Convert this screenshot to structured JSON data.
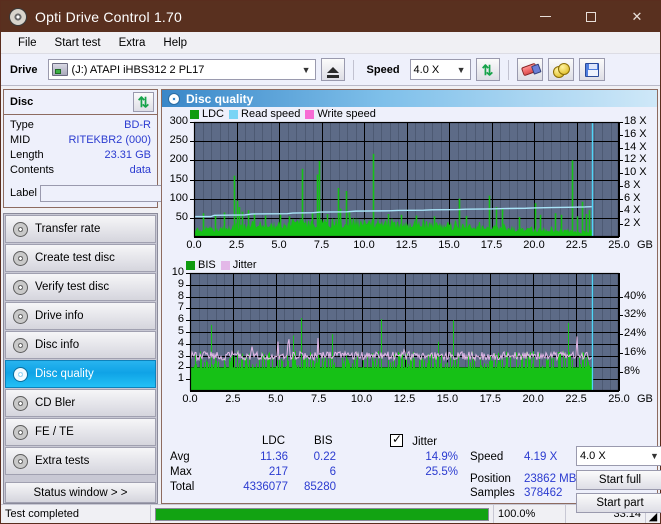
{
  "window": {
    "title": "Opti Drive Control 1.70",
    "icon": "disc-icon",
    "minimize": "—",
    "maximize": "□",
    "close": "✕"
  },
  "menu": {
    "items": [
      "File",
      "Start test",
      "Extra",
      "Help"
    ]
  },
  "toolbar": {
    "drive_label": "Drive",
    "drive_value": "(J:)  ATAPI iHBS312   2 PL17",
    "eject_title": "eject-button",
    "speed_label": "Speed",
    "speed_value": "4.0 X",
    "refresh_title": "refresh-button",
    "erase_title": "erase-button",
    "coins_title": "bookmarks-button",
    "save_title": "save-button"
  },
  "disc": {
    "header": "Disc",
    "refresh_title": "refresh-disc-button",
    "rows": [
      {
        "key": "Type",
        "value": "BD-R"
      },
      {
        "key": "MID",
        "value": "RITEKBR2 (000)"
      },
      {
        "key": "Length",
        "value": "23.31 GB"
      },
      {
        "key": "Contents",
        "value": "data"
      }
    ],
    "label_key": "Label",
    "label_value": "",
    "label_placeholder": ""
  },
  "sidebar": {
    "items": [
      {
        "label": "Transfer rate",
        "active": false
      },
      {
        "label": "Create test disc",
        "active": false
      },
      {
        "label": "Verify test disc",
        "active": false
      },
      {
        "label": "Drive info",
        "active": false
      },
      {
        "label": "Disc info",
        "active": false
      },
      {
        "label": "Disc quality",
        "active": true
      },
      {
        "label": "CD Bler",
        "active": false
      },
      {
        "label": "FE / TE",
        "active": false
      },
      {
        "label": "Extra tests",
        "active": false
      }
    ],
    "status_window": "Status window > >"
  },
  "panel": {
    "title": "Disc quality"
  },
  "chart_data": [
    {
      "id": "ldc-chart",
      "type": "bar",
      "title": "",
      "legend": [
        {
          "label": "LDC",
          "color": "#0f9b0f"
        },
        {
          "label": "Read speed",
          "color": "#79d4f5"
        },
        {
          "label": "Write speed",
          "color": "#f76bd4"
        }
      ],
      "xlabel": "GB",
      "x_ticks": [
        "0.0",
        "2.5",
        "5.0",
        "7.5",
        "10.0",
        "12.5",
        "15.0",
        "17.5",
        "20.0",
        "22.5",
        "25.0"
      ],
      "xlim": [
        0,
        25
      ],
      "ylabel_left": "LDC",
      "y_ticks_left": [
        "300",
        "250",
        "200",
        "150",
        "100",
        "50"
      ],
      "ylim_left": [
        0,
        300
      ],
      "ylabel_right": "Speed",
      "y_ticks_right": [
        "18 X",
        "16 X",
        "14 X",
        "12 X",
        "10 X",
        "8 X",
        "6 X",
        "4 X",
        "2 X"
      ],
      "ylim_right": [
        0,
        18
      ],
      "grid": true,
      "data_end_gb": 23.4,
      "series": [
        {
          "name": "LDC",
          "color": "#16c116",
          "baseline": [
            18,
            22,
            20,
            24,
            21,
            26,
            23,
            27,
            25,
            28,
            24,
            30,
            27,
            26,
            29,
            25,
            31,
            28,
            26,
            30,
            27,
            33,
            29,
            31,
            28,
            34,
            30,
            32,
            29,
            35,
            31,
            33,
            30,
            36,
            32,
            34,
            31,
            37,
            33,
            35,
            32,
            38,
            34,
            36,
            33,
            39,
            35,
            37,
            34,
            40,
            36,
            38,
            35,
            41,
            37,
            39,
            36,
            42,
            38,
            40,
            37,
            43,
            39,
            41,
            38,
            44,
            40,
            42,
            39,
            45,
            41,
            43,
            40,
            46,
            42,
            44,
            41,
            47,
            43,
            45,
            42,
            44,
            41,
            46,
            42,
            43,
            40,
            45,
            41,
            42,
            39,
            44,
            40,
            41,
            38,
            43,
            39,
            40,
            37,
            42,
            38,
            39,
            36,
            41,
            37,
            38,
            35,
            40,
            36,
            37,
            34,
            39,
            35,
            36,
            33,
            38,
            34,
            35,
            32,
            37,
            33,
            34,
            31,
            36,
            32,
            33,
            30,
            35,
            31,
            32,
            29,
            34,
            30,
            31,
            28,
            33,
            29,
            30,
            27,
            32,
            28,
            29,
            26,
            31,
            27,
            28,
            25,
            30,
            26,
            27,
            24,
            29,
            25,
            26,
            23,
            28,
            24,
            25,
            22,
            27,
            23,
            24,
            21,
            26,
            22,
            23,
            20,
            25,
            21,
            22,
            19,
            24,
            20,
            21,
            18,
            23,
            19,
            20,
            17,
            22,
            18,
            19,
            16,
            21,
            17,
            18,
            15,
            20,
            16,
            17,
            14,
            19,
            15,
            16,
            13,
            18,
            14,
            15,
            12,
            17
          ],
          "spikes": [
            {
              "x": 0.55,
              "y": 62
            },
            {
              "x": 1.25,
              "y": 58
            },
            {
              "x": 1.75,
              "y": 64
            },
            {
              "x": 2.35,
              "y": 160
            },
            {
              "x": 2.5,
              "y": 95
            },
            {
              "x": 2.62,
              "y": 78
            },
            {
              "x": 2.8,
              "y": 66
            },
            {
              "x": 3.15,
              "y": 70
            },
            {
              "x": 3.55,
              "y": 60
            },
            {
              "x": 4.2,
              "y": 56
            },
            {
              "x": 5.05,
              "y": 58
            },
            {
              "x": 5.6,
              "y": 54
            },
            {
              "x": 6.35,
              "y": 178
            },
            {
              "x": 6.95,
              "y": 62
            },
            {
              "x": 7.25,
              "y": 163
            },
            {
              "x": 7.35,
              "y": 198
            },
            {
              "x": 7.85,
              "y": 60
            },
            {
              "x": 8.45,
              "y": 128
            },
            {
              "x": 8.6,
              "y": 74
            },
            {
              "x": 8.95,
              "y": 120
            },
            {
              "x": 9.1,
              "y": 66
            },
            {
              "x": 10.55,
              "y": 217
            },
            {
              "x": 11.4,
              "y": 60
            },
            {
              "x": 12.2,
              "y": 58
            },
            {
              "x": 13.05,
              "y": 56
            },
            {
              "x": 14.1,
              "y": 54
            },
            {
              "x": 15.6,
              "y": 100
            },
            {
              "x": 16.0,
              "y": 55
            },
            {
              "x": 17.35,
              "y": 108
            },
            {
              "x": 17.75,
              "y": 78
            },
            {
              "x": 18.1,
              "y": 74
            },
            {
              "x": 19.1,
              "y": 52
            },
            {
              "x": 20.05,
              "y": 88
            },
            {
              "x": 20.35,
              "y": 58
            },
            {
              "x": 21.25,
              "y": 62
            },
            {
              "x": 21.6,
              "y": 58
            },
            {
              "x": 22.25,
              "y": 200
            },
            {
              "x": 22.55,
              "y": 54
            },
            {
              "x": 22.85,
              "y": 92
            },
            {
              "x": 23.05,
              "y": 60
            },
            {
              "x": 23.25,
              "y": 70
            }
          ]
        },
        {
          "name": "Read speed",
          "color": "#79d4f5",
          "points": [
            {
              "x": 0.0,
              "y": 3.2
            },
            {
              "x": 1.0,
              "y": 3.2
            },
            {
              "x": 1.2,
              "y": 3.4
            },
            {
              "x": 3.0,
              "y": 3.45
            },
            {
              "x": 3.4,
              "y": 3.6
            },
            {
              "x": 5.5,
              "y": 3.65
            },
            {
              "x": 5.8,
              "y": 3.75
            },
            {
              "x": 7.0,
              "y": 3.8
            },
            {
              "x": 7.4,
              "y": 3.9
            },
            {
              "x": 9.0,
              "y": 3.95
            },
            {
              "x": 9.5,
              "y": 4.05
            },
            {
              "x": 11.5,
              "y": 4.1
            },
            {
              "x": 12.0,
              "y": 4.15
            },
            {
              "x": 13.5,
              "y": 4.2
            },
            {
              "x": 14.0,
              "y": 4.25
            },
            {
              "x": 15.5,
              "y": 4.3
            },
            {
              "x": 16.0,
              "y": 4.35
            },
            {
              "x": 17.5,
              "y": 4.4
            },
            {
              "x": 18.2,
              "y": 4.45
            },
            {
              "x": 19.5,
              "y": 4.5
            },
            {
              "x": 20.0,
              "y": 4.55
            },
            {
              "x": 21.0,
              "y": 4.6
            },
            {
              "x": 22.0,
              "y": 4.65
            },
            {
              "x": 23.0,
              "y": 4.7
            },
            {
              "x": 23.4,
              "y": 4.75
            }
          ]
        },
        {
          "name": "Cursor",
          "color": "#4fd6f8",
          "vertical_line_x": 23.4
        }
      ]
    },
    {
      "id": "bis-jitter-chart",
      "type": "bar",
      "title": "",
      "legend": [
        {
          "label": "BIS",
          "color": "#0f9b0f"
        },
        {
          "label": "Jitter",
          "color": "#e3b8e8"
        }
      ],
      "xlabel": "GB",
      "x_ticks": [
        "0.0",
        "2.5",
        "5.0",
        "7.5",
        "10.0",
        "12.5",
        "15.0",
        "17.5",
        "20.0",
        "22.5",
        "25.0"
      ],
      "xlim": [
        0,
        25
      ],
      "ylabel_left": "BIS",
      "y_ticks_left": [
        "10",
        "9",
        "8",
        "7",
        "6",
        "5",
        "4",
        "3",
        "2",
        "1"
      ],
      "ylim_left": [
        0,
        10
      ],
      "ylabel_right": "Jitter",
      "y_ticks_right": [
        "40%",
        "32%",
        "24%",
        "16%",
        "8%"
      ],
      "ylim_right": [
        0,
        50
      ],
      "grid": true,
      "data_end_gb": 23.4,
      "series": [
        {
          "name": "BIS",
          "color": "#16c116",
          "avg_level": 2.0,
          "noise_max": 3.4
        },
        {
          "name": "Jitter",
          "color": "#e3b8e8",
          "avg_percent": 14.9,
          "max_percent": 25.5
        },
        {
          "name": "Cursor",
          "color": "#4fd6f8",
          "vertical_line_x": 23.4
        }
      ]
    }
  ],
  "stats": {
    "col_headers": [
      "LDC",
      "BIS"
    ],
    "jitter_label": "Jitter",
    "jitter_checked": true,
    "rows": [
      {
        "name": "Avg",
        "ldc": "11.36",
        "bis": "0.22",
        "jitter": "14.9%"
      },
      {
        "name": "Max",
        "ldc": "217",
        "bis": "6",
        "jitter": "25.5%"
      },
      {
        "name": "Total",
        "ldc": "4336077",
        "bis": "85280",
        "jitter": ""
      }
    ],
    "speed_label": "Speed",
    "speed_value": "4.19 X",
    "speed_select": "4.0 X",
    "position_label": "Position",
    "position_value": "23862 MB",
    "samples_label": "Samples",
    "samples_value": "378462",
    "start_full": "Start full",
    "start_part": "Start part"
  },
  "statusbar": {
    "message": "Test completed",
    "progress_percent": 100.0,
    "progress_text": "100.0%",
    "elapsed": "33:14"
  },
  "colors": {
    "title_bar": "#59301f",
    "accent_blue": "#2b3bd0",
    "plot_bg": "#5d6b87",
    "green": "#16c116",
    "cyan": "#4fd6f8",
    "pink": "#e3b8e8",
    "progress_green": "#12a312",
    "active_nav": "#0fa3e6"
  }
}
